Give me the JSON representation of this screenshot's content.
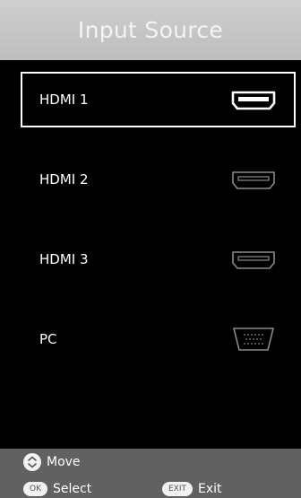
{
  "header": {
    "title": "Input Source"
  },
  "sources": [
    {
      "label": "HDMI 1",
      "icon": "hdmi-port-icon",
      "selected": true
    },
    {
      "label": "HDMI 2",
      "icon": "hdmi-port-icon",
      "selected": false
    },
    {
      "label": "HDMI 3",
      "icon": "hdmi-port-icon",
      "selected": false
    },
    {
      "label": "PC",
      "icon": "vga-port-icon",
      "selected": false
    }
  ],
  "footer": {
    "move_label": "Move",
    "ok_badge": "OK",
    "select_label": "Select",
    "exit_badge": "EXIT",
    "exit_label": "Exit"
  },
  "colors": {
    "header_bg": "#c6c6c6",
    "footer_bg": "#616161",
    "selected_border": "#ffffff",
    "icon_active": "#ffffff",
    "icon_inactive": "#8a8a8a"
  }
}
